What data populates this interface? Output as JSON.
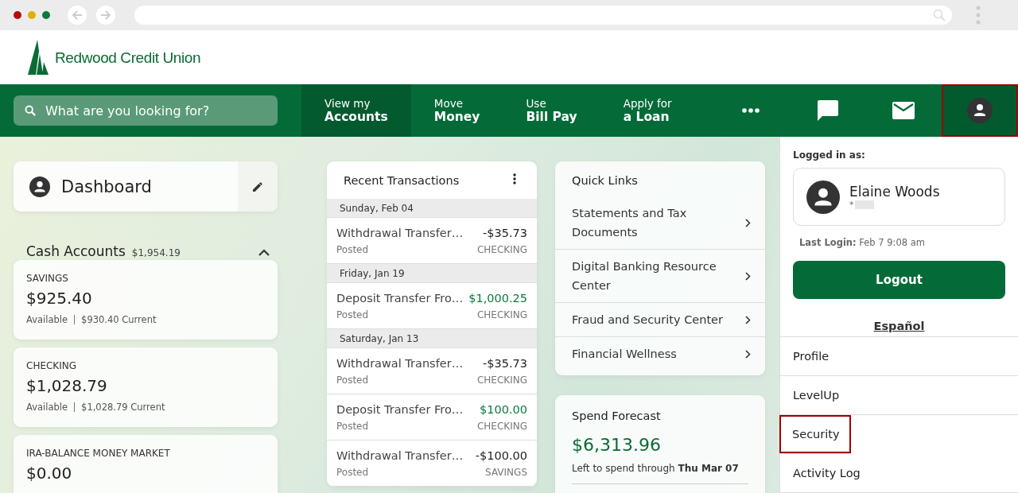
{
  "brand": {
    "name": "Redwood Credit Union"
  },
  "search": {
    "placeholder": "What are you looking for?"
  },
  "nav": [
    {
      "line1": "View my",
      "line2": "Accounts",
      "selected": true
    },
    {
      "line1": "Move",
      "line2": "Money",
      "selected": false
    },
    {
      "line1": "Use",
      "line2": "Bill Pay",
      "selected": false
    },
    {
      "line1": "Apply for",
      "line2": "a Loan",
      "selected": false
    }
  ],
  "nav_icons": [
    {
      "kind": "more",
      "highlighted": false
    },
    {
      "kind": "chat",
      "highlighted": false
    },
    {
      "kind": "mail",
      "highlighted": false
    },
    {
      "kind": "profile",
      "highlighted": true
    }
  ],
  "dashboard": {
    "title": "Dashboard"
  },
  "cash_accounts": {
    "title": "Cash Accounts",
    "total": "$1,954.19",
    "expanded": true,
    "accounts": [
      {
        "name": "SAVINGS",
        "balance": "$925.40",
        "available_label": "Available",
        "current": "$930.40 Current"
      },
      {
        "name": "CHECKING",
        "balance": "$1,028.79",
        "available_label": "Available",
        "current": "$1,028.79 Current"
      },
      {
        "name": "IRA-BALANCE MONEY MARKET",
        "balance": "$0.00"
      }
    ]
  },
  "transactions": {
    "title": "Recent Transactions",
    "groups": [
      {
        "date": "Sunday, Feb 04",
        "items": [
          {
            "description": "Withdrawal Transfer…",
            "amount": "-$35.73",
            "kind": "debit",
            "status": "Posted",
            "account": "CHECKING"
          }
        ]
      },
      {
        "date": "Friday, Jan 19",
        "items": [
          {
            "description": "Deposit Transfer Fro…",
            "amount": "$1,000.25",
            "kind": "credit",
            "status": "Posted",
            "account": "CHECKING"
          }
        ]
      },
      {
        "date": "Saturday, Jan 13",
        "items": [
          {
            "description": "Withdrawal Transfer…",
            "amount": "-$35.73",
            "kind": "debit",
            "status": "Posted",
            "account": "CHECKING"
          },
          {
            "description": "Deposit Transfer Fro…",
            "amount": "$100.00",
            "kind": "credit",
            "status": "Posted",
            "account": "CHECKING"
          },
          {
            "description": "Withdrawal Transfer…",
            "amount": "-$100.00",
            "kind": "debit",
            "status": "Posted",
            "account": "SAVINGS"
          }
        ]
      }
    ]
  },
  "quick_links": {
    "title": "Quick Links",
    "items": [
      "Statements and Tax Documents",
      "Digital Banking Resource Center",
      "Fraud and Security Center",
      "Financial Wellness"
    ]
  },
  "spend_forecast": {
    "title": "Spend Forecast",
    "amount": "$6,313.96",
    "note": "Left to spend through **Thu Mar 07**"
  },
  "account_menu": {
    "logged_in_label": "Logged in as:",
    "user_name": "Elaine Woods",
    "masked_id": "*",
    "last_login": "**Last Login:** Feb 7 9:08 am",
    "logout": "Logout",
    "language_link": "Español",
    "items": [
      {
        "label": "Profile",
        "highlighted": false
      },
      {
        "label": "LevelUp",
        "highlighted": false
      },
      {
        "label": "Security",
        "highlighted": true
      },
      {
        "label": "Activity Log",
        "highlighted": false
      }
    ]
  }
}
